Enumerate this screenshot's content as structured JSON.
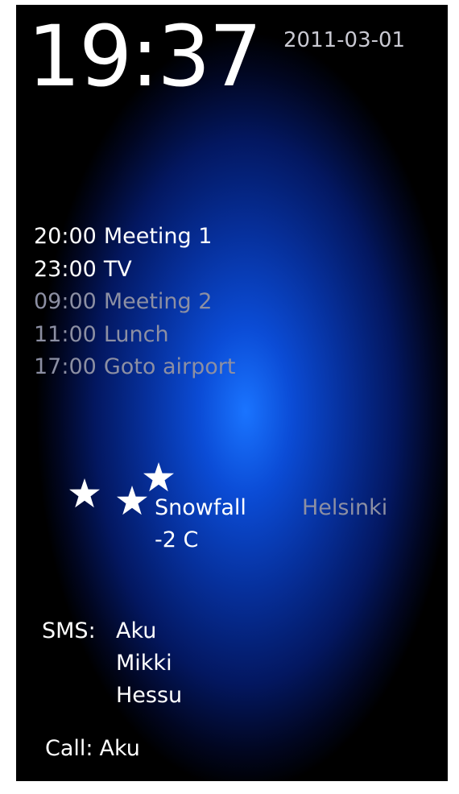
{
  "clock": {
    "time": "19:37",
    "date": "2011-03-01"
  },
  "agenda": [
    {
      "time": "20:00",
      "title": "Meeting 1",
      "state": "today"
    },
    {
      "time": "23:00",
      "title": "TV",
      "state": "today"
    },
    {
      "time": "09:00",
      "title": "Meeting 2",
      "state": "later"
    },
    {
      "time": "11:00",
      "title": "Lunch",
      "state": "later"
    },
    {
      "time": "17:00",
      "title": "Goto airport",
      "state": "later"
    }
  ],
  "weather": {
    "icon": "snowflake-stars-icon",
    "condition": "Snowfall",
    "temperature": "-2 C",
    "city": "Helsinki"
  },
  "sms": {
    "label": "SMS:",
    "senders": [
      "Aku",
      "Mikki",
      "Hessu"
    ]
  },
  "call": {
    "label": "Call:",
    "caller": "Aku"
  },
  "colors": {
    "background_center": "#1a74ff",
    "background_edge": "#000000",
    "primary_text": "#ffffff",
    "secondary_text": "#8c8fa3"
  }
}
